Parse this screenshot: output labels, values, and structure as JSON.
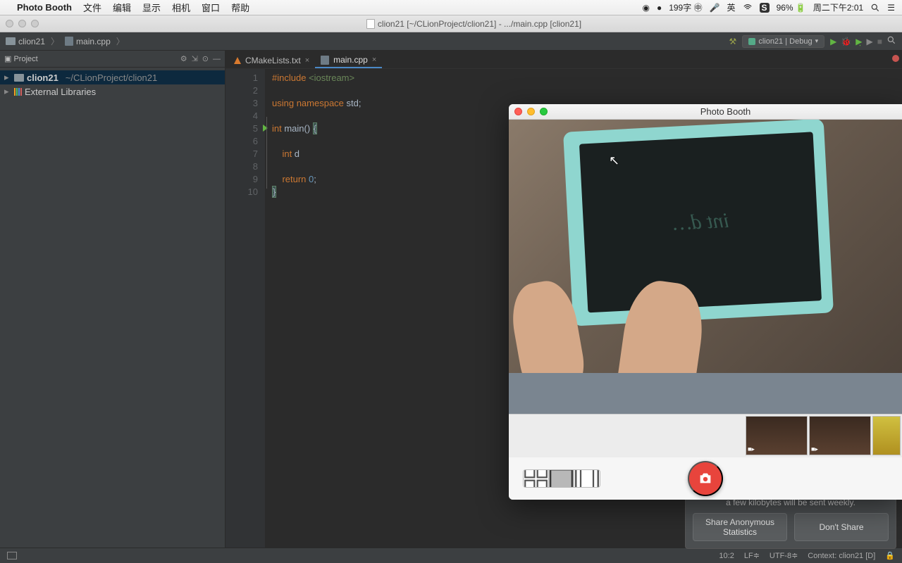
{
  "menubar": {
    "appname": "Photo Booth",
    "items": [
      "文件",
      "编辑",
      "显示",
      "相机",
      "窗口",
      "帮助"
    ],
    "ime": "199字",
    "battery_pct": "96%",
    "clock": "周二下午2:01"
  },
  "clion_window": {
    "title": "clion21 [~/CLionProject/clion21] - .../main.cpp [clion21]"
  },
  "navbar": {
    "crumb_folder": "clion21",
    "crumb_file": "main.cpp",
    "run_config": "clion21 | Debug"
  },
  "project_panel": {
    "title": "Project",
    "root_name": "clion21",
    "root_path": "~/CLionProject/clion21",
    "ext_lib": "External Libraries"
  },
  "editor_tabs": {
    "t1": "CMakeLists.txt",
    "t2": "main.cpp"
  },
  "code_lines": [
    "#include <iostream>",
    "",
    "using namespace std;",
    "",
    "int main() {",
    "",
    "    int d",
    "",
    "    return 0;",
    "}"
  ],
  "statusbar": {
    "pos": "10:2",
    "eol": "LF",
    "enc": "UTF-8",
    "context": "Context: clion21 [D]"
  },
  "stats_popup": {
    "msg": "a few kilobytes will be sent weekly.",
    "share": "Share Anonymous Statistics",
    "dont": "Don't Share"
  },
  "photobooth": {
    "title": "Photo Booth",
    "writing": "int d…"
  }
}
